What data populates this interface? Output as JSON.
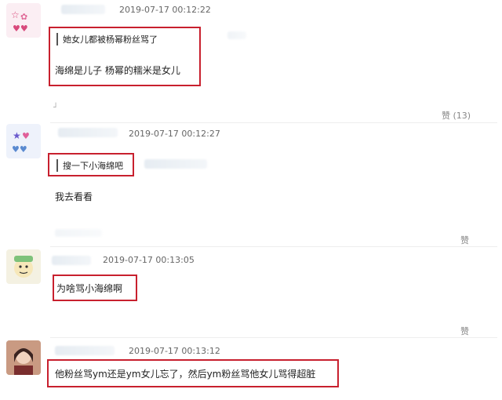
{
  "comments": [
    {
      "timestamp": "2019-07-17 00:12:22",
      "quote": "她女儿都被杨幂粉丝骂了",
      "text": "海绵是儿子 杨幂的糯米是女儿",
      "like": "赞 (13)"
    },
    {
      "timestamp": "2019-07-17 00:12:27",
      "quote": "搜一下小海绵吧",
      "text": "我去看看",
      "like": "赞"
    },
    {
      "timestamp": "2019-07-17 00:13:05",
      "text": "为啥骂小海绵啊",
      "like": "赞"
    },
    {
      "timestamp": "2019-07-17 00:13:12",
      "text": "他粉丝骂ym还是ym女儿忘了，然后ym粉丝骂他女儿骂得超脏"
    }
  ],
  "icons": {
    "reply": "reply-icon",
    "like": "like-icon"
  },
  "colors": {
    "highlight": "#c8202e"
  }
}
